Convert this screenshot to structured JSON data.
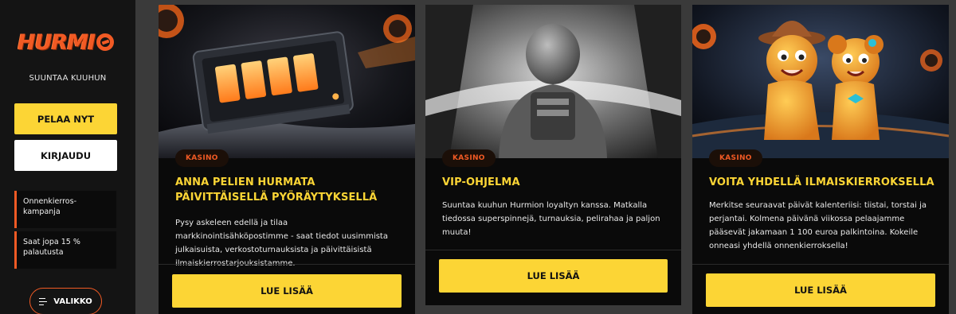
{
  "sidebar": {
    "logo_text": "HURMI",
    "tagline": "SUUNTAA KUUHUN",
    "play_button": "PELAA NYT",
    "login_button": "KIRJAUDU",
    "promos": [
      "Onnenkierros-kampanja",
      "Saat jopa 15 % palautusta"
    ],
    "menu_button": "VALIKKO"
  },
  "colors": {
    "accent_orange": "#f15a24",
    "accent_yellow": "#fcd535",
    "card_bg": "#0a0a0a",
    "sidebar_bg": "#141414",
    "page_bg": "#3a3a3a"
  },
  "cards": [
    {
      "badge": "KASINO",
      "title": "ANNA PELIEN HURMATA PÄIVITTÄISELLÄ PYÖRÄYTYKSELLÄ",
      "text": "Pysy askeleen edellä ja tilaa markkinointisähköpostimme - saat tiedot uusimmista julkaisuista, verkostoturnauksista ja päivittäisistä ilmaiskierrostarjouksistamme.",
      "button": "LUE LISÄÄ",
      "image": "slot-machine-spaceship"
    },
    {
      "badge": "KASINO",
      "title": "VIP-OHJELMA",
      "text": "Suuntaa kuuhun Hurmion loyaltyn kanssa. Matkalla tiedossa superspinnejä, turnauksia, pelirahaa ja paljon muuta!",
      "button": "LUE LISÄÄ",
      "image": "astronaut"
    },
    {
      "badge": "KASINO",
      "title": "VOITA YHDELLÄ ILMAISKIERROKSELLA",
      "text": "Merkitse seuraavat päivät kalenteriisi: tiistai, torstai ja perjantai. Kolmena päivänä viikossa pelaajamme pääsevät jakamaan 1 100 euroa palkintoina. Kokeile onneasi yhdellä onnenkierroksella!",
      "button": "LUE LISÄÄ",
      "image": "gingerbread-characters"
    }
  ]
}
